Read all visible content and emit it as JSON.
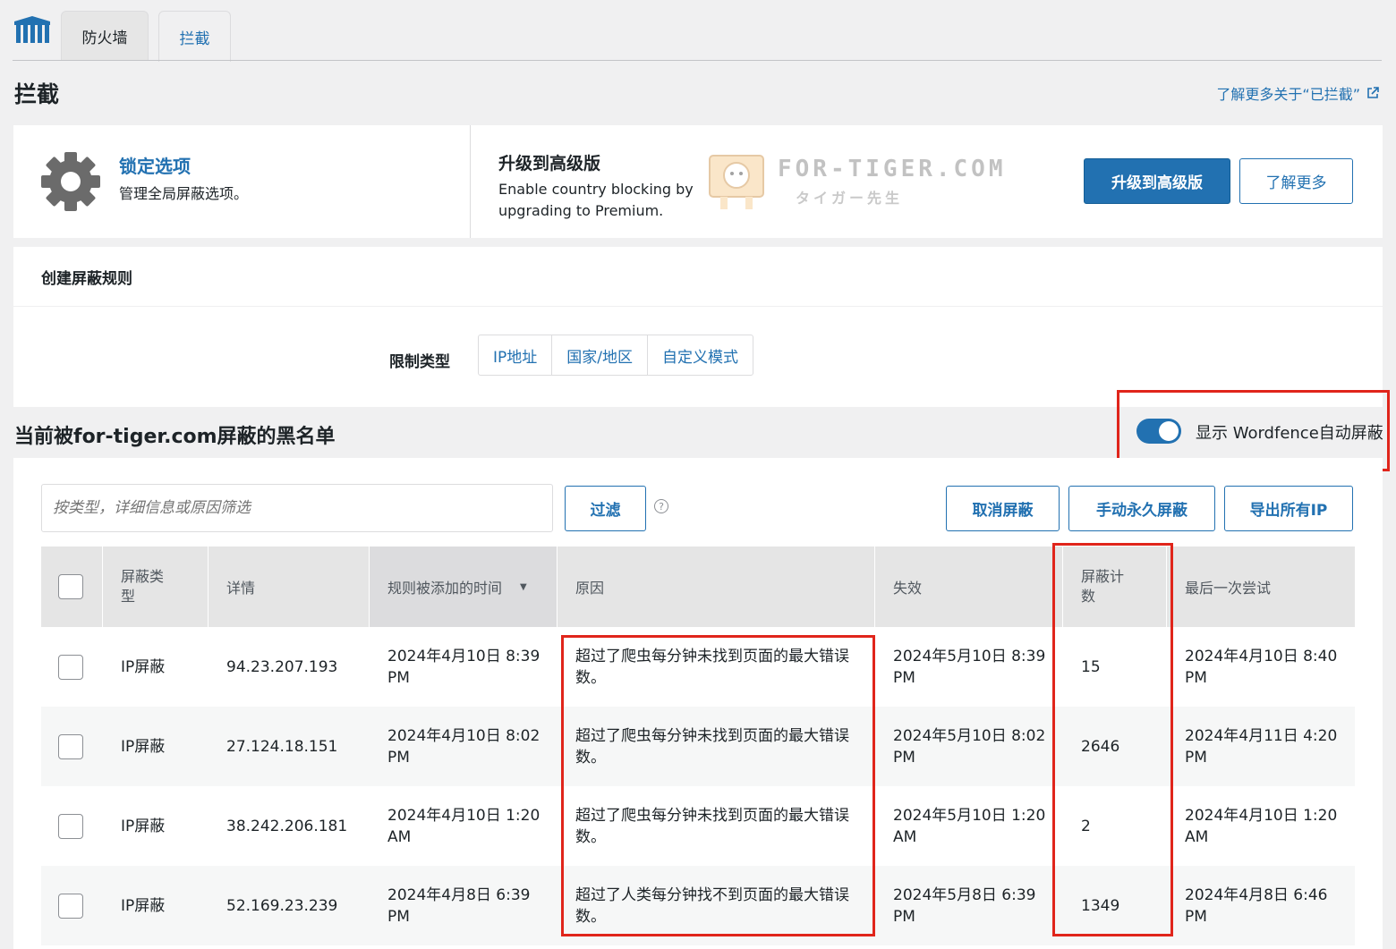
{
  "tabs": [
    {
      "label": "防火墙"
    },
    {
      "label": "拦截"
    }
  ],
  "page_title": "拦截",
  "learn_more_link": "了解更多关于“已拦截”",
  "lock_options": {
    "title": "锁定选项",
    "subtitle": "管理全局屏蔽选项。"
  },
  "upgrade": {
    "title": "升级到高级版",
    "desc": "Enable country blocking by upgrading to Premium.",
    "primary_button": "升级到高级版",
    "secondary_button": "了解更多"
  },
  "watermark": {
    "text": "FOR-TIGER.COM",
    "sub": "タイガー先生"
  },
  "create_rule": {
    "title": "创建屏蔽规则",
    "restrict_label": "限制类型",
    "options": [
      "IP地址",
      "国家/地区",
      "自定义模式"
    ]
  },
  "blacklist": {
    "title": "当前被for-tiger.com屏蔽的黑名单",
    "toggle_label": "显示 Wordfence自动屏蔽",
    "toggle_on": true
  },
  "toolbar": {
    "filter_placeholder": "按类型，详细信息或原因筛选",
    "filter_button": "过滤",
    "help": "?",
    "unblock_button": "取消屏蔽",
    "permanent_button": "手动永久屏蔽",
    "export_button": "导出所有IP"
  },
  "table": {
    "headers": [
      "屏蔽类型",
      "详情",
      "规则被添加的时间",
      "原因",
      "失效",
      "屏蔽计数",
      "最后一次尝试"
    ],
    "rows": [
      {
        "type": "IP屏蔽",
        "detail": "94.23.207.193",
        "added": "2024年4月10日 8:39 PM",
        "reason": "超过了爬虫每分钟未找到页面的最大错误数。",
        "expires": "2024年5月10日 8:39 PM",
        "count": "15",
        "last": "2024年4月10日 8:40 PM"
      },
      {
        "type": "IP屏蔽",
        "detail": "27.124.18.151",
        "added": "2024年4月10日 8:02 PM",
        "reason": "超过了爬虫每分钟未找到页面的最大错误数。",
        "expires": "2024年5月10日 8:02 PM",
        "count": "2646",
        "last": "2024年4月11日 4:20 PM"
      },
      {
        "type": "IP屏蔽",
        "detail": "38.242.206.181",
        "added": "2024年4月10日 1:20 AM",
        "reason": "超过了爬虫每分钟未找到页面的最大错误数。",
        "expires": "2024年5月10日 1:20 AM",
        "count": "2",
        "last": "2024年4月10日 1:20 AM"
      },
      {
        "type": "IP屏蔽",
        "detail": "52.169.23.239",
        "added": "2024年4月8日 6:39 PM",
        "reason": "超过了人类每分钟找不到页面的最大错误数。",
        "expires": "2024年5月8日 6:39 PM",
        "count": "1349",
        "last": "2024年4月8日 6:46 PM"
      }
    ]
  },
  "colors": {
    "accent": "#2271b1",
    "highlight": "#e0251b"
  }
}
